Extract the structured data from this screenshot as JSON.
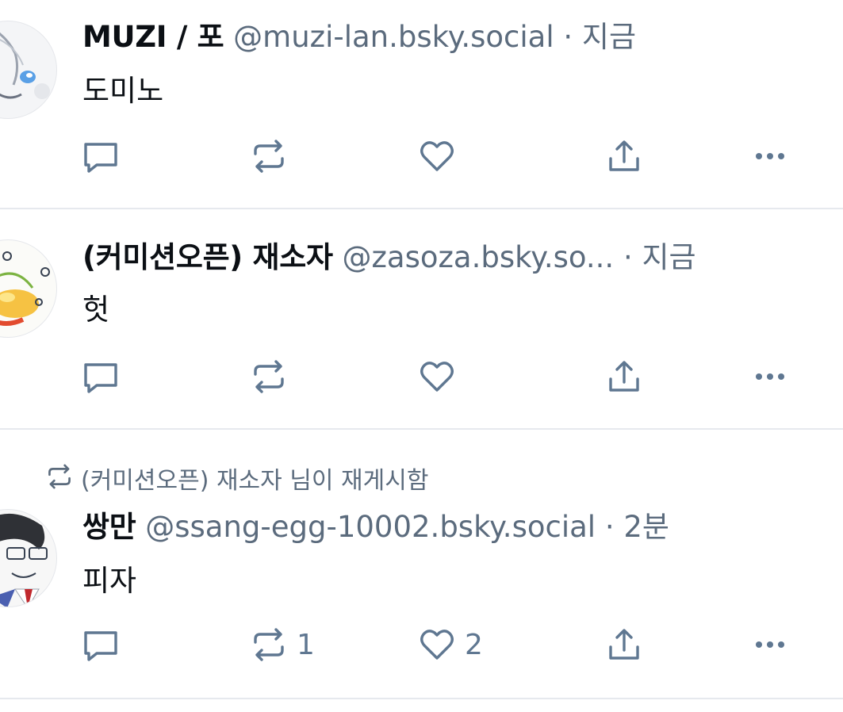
{
  "posts": [
    {
      "author": "MUZI / 포",
      "handle": "@muzi-lan.bsky.social",
      "separator": "·",
      "time": "지금",
      "text": "도미노",
      "reply_count": "",
      "repost_count": "",
      "like_count": ""
    },
    {
      "author": "(커미션오픈) 재소자",
      "handle": "@zasoza.bsky.so...",
      "separator": "·",
      "time": "지금",
      "text": "헛",
      "reply_count": "",
      "repost_count": "",
      "like_count": ""
    },
    {
      "reposted_by": "(커미션오픈) 재소자 님이 재게시함",
      "author": "쌍만",
      "handle": "@ssang-egg-10002.bsky.social",
      "separator": "·",
      "time": "2분",
      "text": "피자",
      "reply_count": "",
      "repost_count": "1",
      "like_count": "2"
    }
  ],
  "icons": {
    "reply": "reply-icon",
    "repost": "repost-icon",
    "like": "heart-icon",
    "share": "share-icon",
    "more": "more-icon"
  },
  "colors": {
    "icon": "#5f7791",
    "muted_text": "#5b6b7d",
    "divider": "#e6e9ee"
  }
}
